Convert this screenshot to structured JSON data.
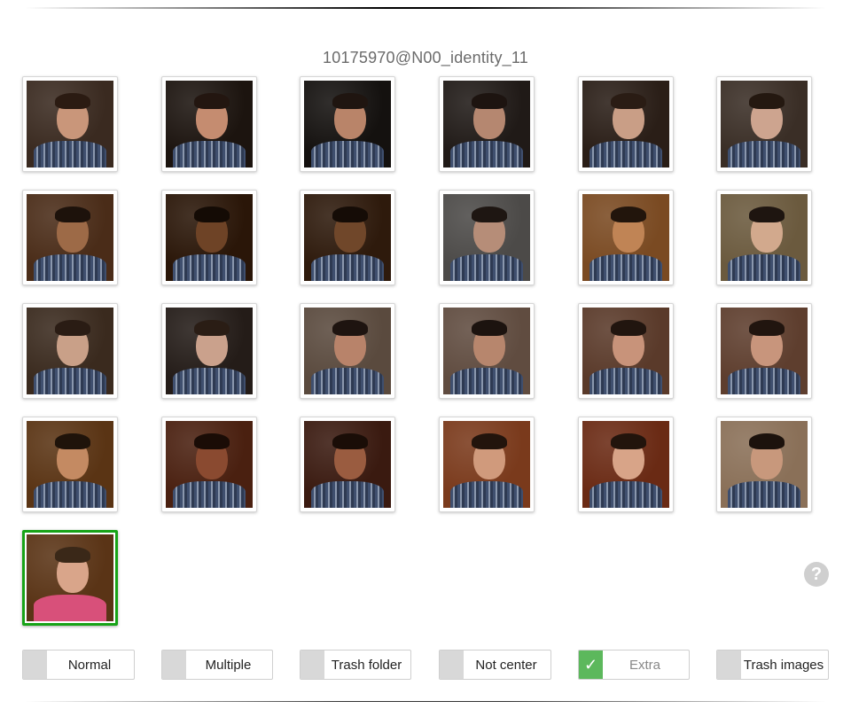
{
  "title": "10175970@N00_identity_11",
  "thumbnails": [
    {
      "bg": "#3a2a20",
      "face": "#c9967a",
      "hair": "#2b1b12",
      "selected": false
    },
    {
      "bg": "#1c140f",
      "face": "#c58c70",
      "hair": "#231610",
      "selected": false
    },
    {
      "bg": "#14110f",
      "face": "#b98469",
      "hair": "#1f1510",
      "selected": false
    },
    {
      "bg": "#201a17",
      "face": "#b58770",
      "hair": "#1d1410",
      "selected": false
    },
    {
      "bg": "#2a1e17",
      "face": "#c99e86",
      "hair": "#2a1c14",
      "selected": false
    },
    {
      "bg": "#3a2e26",
      "face": "#cda48f",
      "hair": "#241810",
      "selected": false
    },
    {
      "bg": "#4a2c18",
      "face": "#9d6a47",
      "hair": "#1d120b",
      "selected": false
    },
    {
      "bg": "#2a1608",
      "face": "#6e4326",
      "hair": "#140b05",
      "selected": false
    },
    {
      "bg": "#2e1a0c",
      "face": "#70472a",
      "hair": "#150c06",
      "selected": false
    },
    {
      "bg": "#4c4a48",
      "face": "#b68d78",
      "hair": "#1e1612",
      "selected": false
    },
    {
      "bg": "#7a4a22",
      "face": "#c08455",
      "hair": "#22150c",
      "selected": false
    },
    {
      "bg": "#6b5a3e",
      "face": "#d2a98d",
      "hair": "#1e1510",
      "selected": false
    },
    {
      "bg": "#3a2a1e",
      "face": "#c9a088",
      "hair": "#2a1c14",
      "selected": false
    },
    {
      "bg": "#241c18",
      "face": "#caa18c",
      "hair": "#2a1d15",
      "selected": false
    },
    {
      "bg": "#5a4a3e",
      "face": "#b8836a",
      "hair": "#1e1410",
      "selected": false
    },
    {
      "bg": "#604c40",
      "face": "#b7866d",
      "hair": "#1c130f",
      "selected": false
    },
    {
      "bg": "#5a3a2a",
      "face": "#c8937a",
      "hair": "#21150f",
      "selected": false
    },
    {
      "bg": "#5e3e2e",
      "face": "#c8957c",
      "hair": "#21150f",
      "selected": false
    },
    {
      "bg": "#5a3414",
      "face": "#c48a62",
      "hair": "#1f130a",
      "selected": false
    },
    {
      "bg": "#4a2010",
      "face": "#8a4a30",
      "hair": "#1a0c06",
      "selected": false
    },
    {
      "bg": "#3a1a10",
      "face": "#9a5c40",
      "hair": "#1a0d07",
      "selected": false
    },
    {
      "bg": "#7a3a1c",
      "face": "#d09a7c",
      "hair": "#22140c",
      "selected": false
    },
    {
      "bg": "#6a2a14",
      "face": "#d8a488",
      "hair": "#22140c",
      "selected": false
    },
    {
      "bg": "#8a7058",
      "face": "#c8987c",
      "hair": "#1c120c",
      "selected": false
    },
    {
      "bg": "#5a3416",
      "face": "#d9a58a",
      "hair": "#3a2818",
      "selected": true
    }
  ],
  "buttons": [
    {
      "label": "Normal",
      "checked": false
    },
    {
      "label": "Multiple",
      "checked": false
    },
    {
      "label": "Trash folder",
      "checked": false
    },
    {
      "label": "Not center",
      "checked": false
    },
    {
      "label": "Extra",
      "checked": true
    },
    {
      "label": "Trash images",
      "checked": false
    }
  ],
  "help_icon_glyph": "?",
  "check_glyph": "✓",
  "colors": {
    "selected_border": "#17a317",
    "checked_box": "#5cb85c",
    "unchecked_box": "#d8d8d8"
  }
}
